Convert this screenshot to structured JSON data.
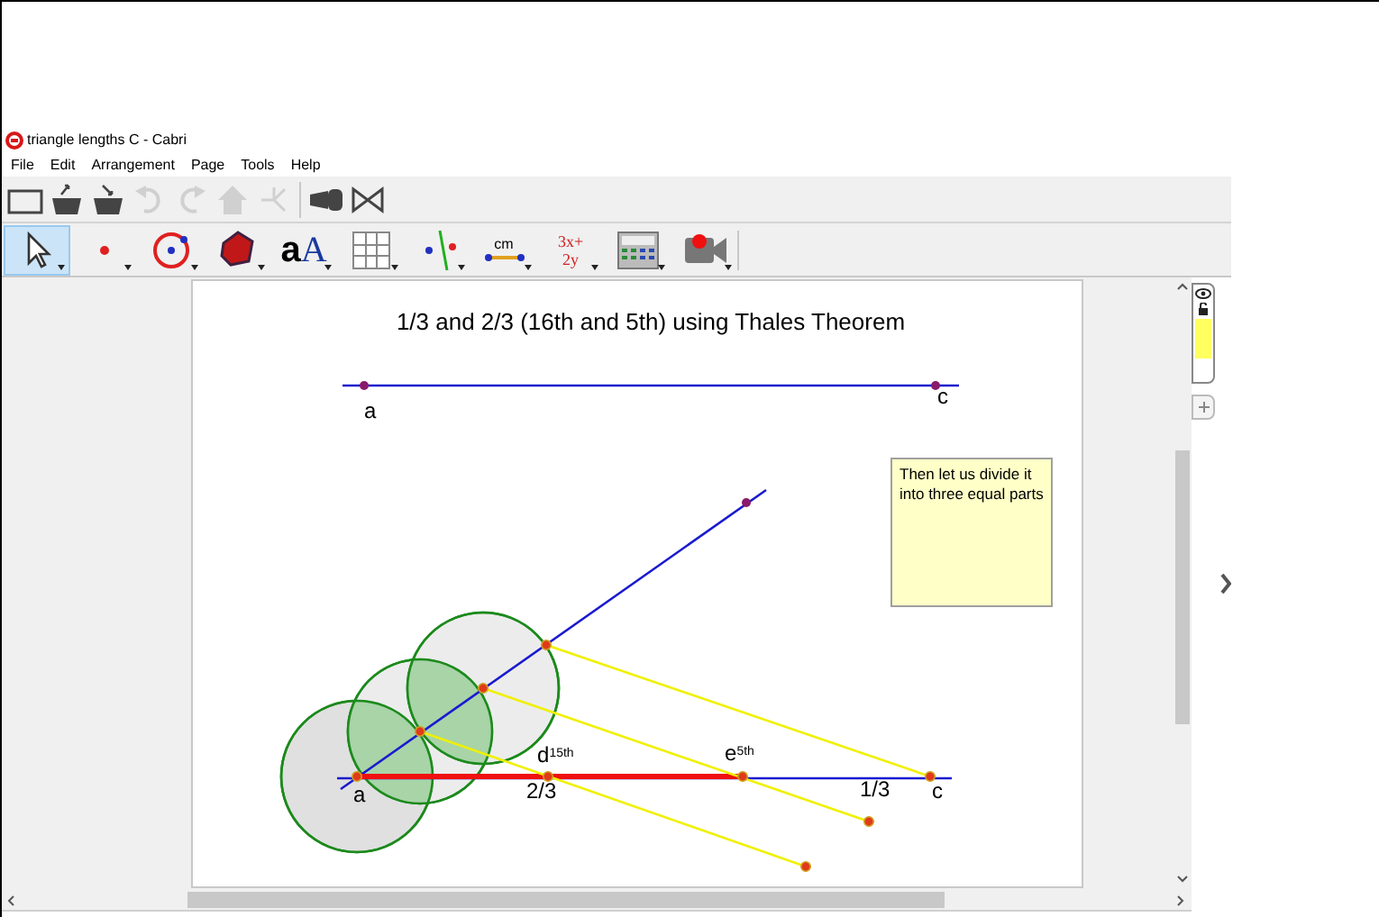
{
  "window": {
    "title": "triangle lengths C - Cabri"
  },
  "menu": [
    "File",
    "Edit",
    "Arrangement",
    "Page",
    "Tools",
    "Help"
  ],
  "toolbar_file": [
    {
      "kind": "new",
      "disabled": false
    },
    {
      "kind": "open",
      "disabled": false
    },
    {
      "kind": "save",
      "disabled": false
    },
    {
      "kind": "undo",
      "disabled": true
    },
    {
      "kind": "redo",
      "disabled": true
    },
    {
      "kind": "home",
      "disabled": true
    },
    {
      "kind": "tree",
      "disabled": true
    },
    {
      "kind": "flashlight",
      "disabled": false
    },
    {
      "kind": "bowtie",
      "disabled": false
    }
  ],
  "toolbar_tools": [
    {
      "kind": "pointer",
      "selected": true
    },
    {
      "kind": "point",
      "selected": false
    },
    {
      "kind": "circle",
      "selected": false
    },
    {
      "kind": "solid",
      "selected": false
    },
    {
      "kind": "text",
      "label": "a",
      "label2": "A",
      "selected": false
    },
    {
      "kind": "table",
      "selected": false
    },
    {
      "kind": "construct",
      "selected": false
    },
    {
      "kind": "measure",
      "label": "cm",
      "selected": false
    },
    {
      "kind": "calculate",
      "label": "3x+\n2y",
      "selected": false
    },
    {
      "kind": "calculator",
      "selected": false
    },
    {
      "kind": "record",
      "selected": false
    }
  ],
  "sheet": {
    "title": "1/3 and 2/3 (16th and 5th) using Thales Theorem",
    "labels": [
      "a",
      "c",
      "a",
      "d$^{15th}$",
      "e$^{5th}$",
      "2/3",
      "1/3",
      "c"
    ],
    "note": "Then let us divide it into three equal parts"
  },
  "side_tabs": [
    {
      "kind": "view",
      "selected": true
    },
    {
      "kind": "add",
      "selected": false
    }
  ]
}
